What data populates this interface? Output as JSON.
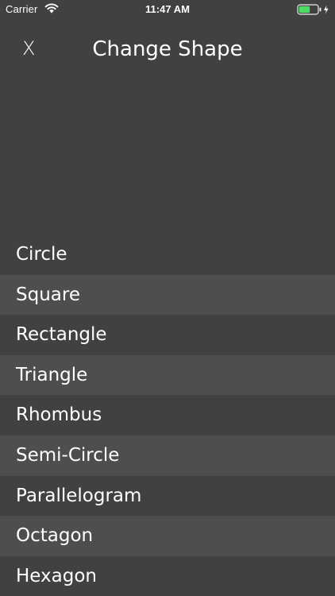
{
  "status_bar": {
    "carrier": "Carrier",
    "time": "11:47 AM",
    "battery_level": 0.6,
    "battery_color": "#4cd964"
  },
  "header": {
    "close_label": "X",
    "title": "Change Shape"
  },
  "shapes": [
    "Circle",
    "Square",
    "Rectangle",
    "Triangle",
    "Rhombus",
    "Semi-Circle",
    "Parallelogram",
    "Octagon",
    "Hexagon"
  ],
  "colors": {
    "background": "#414141",
    "row_alt": "#4e4e4e",
    "text": "#ffffff"
  }
}
